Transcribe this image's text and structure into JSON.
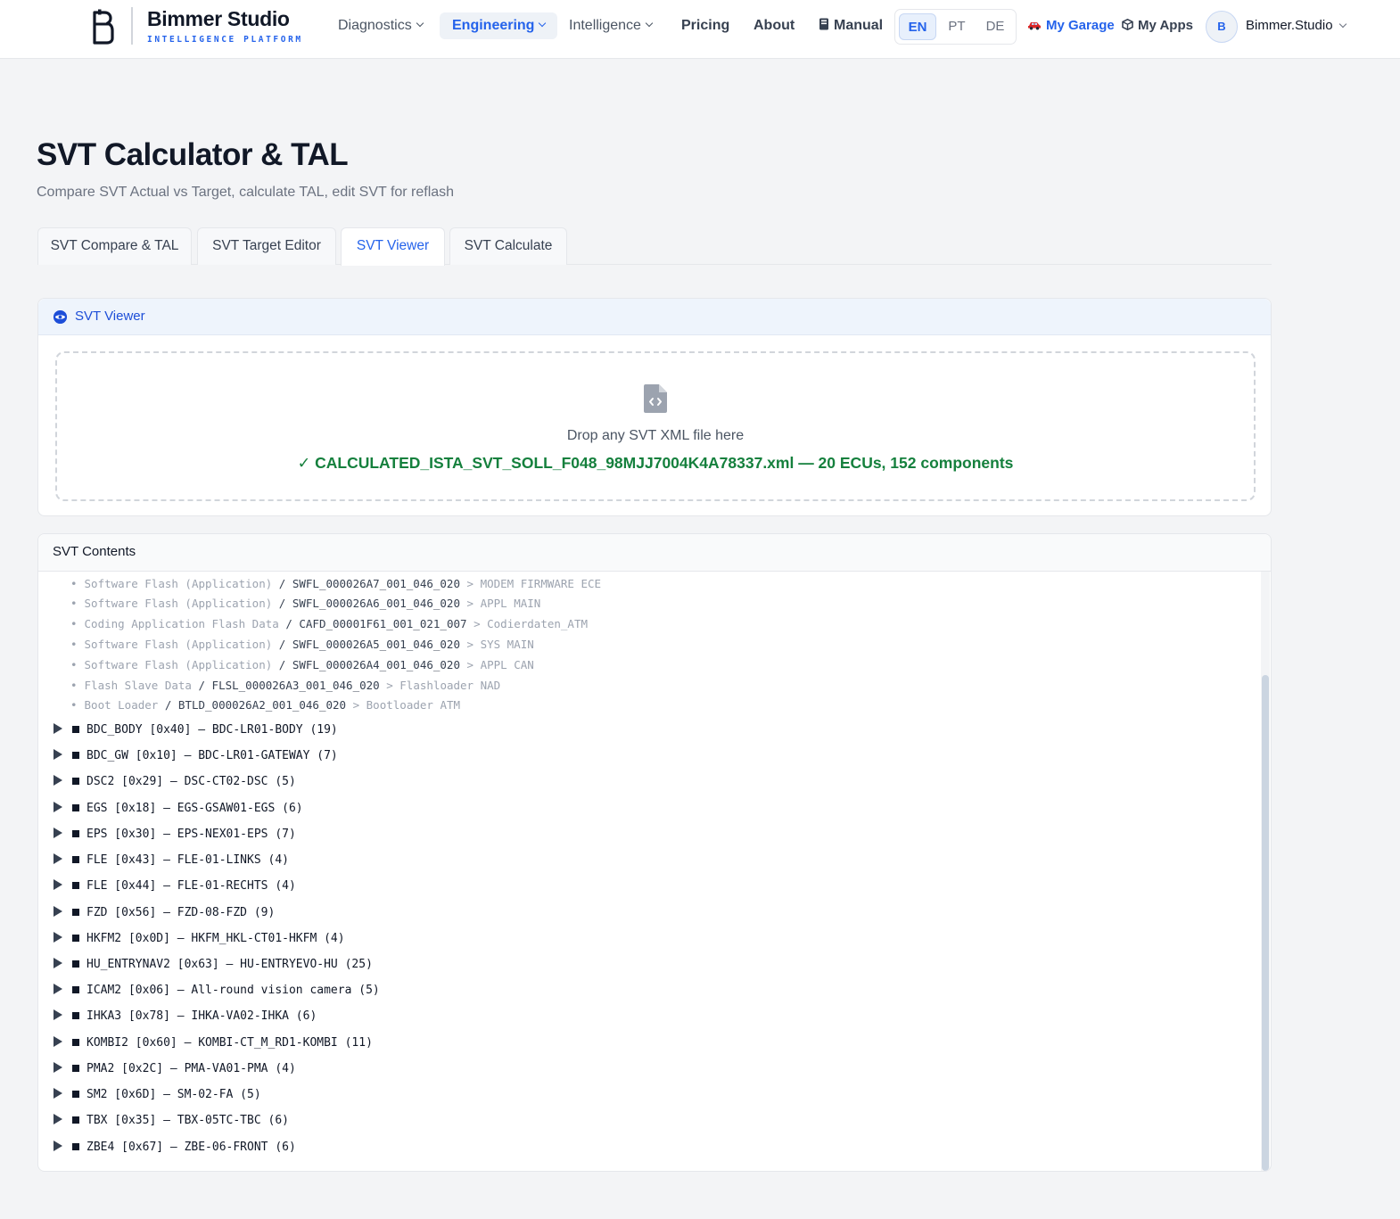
{
  "brand": {
    "name": "Bimmer Studio",
    "tagline": "INTELLIGENCE PLATFORM"
  },
  "nav": {
    "diagnostics": "Diagnostics",
    "engineering": "Engineering",
    "intelligence": "Intelligence",
    "pricing": "Pricing",
    "about": "About",
    "manual": "Manual"
  },
  "lang": {
    "en": "EN",
    "pt": "PT",
    "de": "DE",
    "selected": "EN"
  },
  "user_nav": {
    "garage": "My Garage",
    "apps": "My Apps",
    "avatar_initial": "B",
    "user_name": "Bimmer.Studio"
  },
  "page": {
    "title": "SVT Calculator & TAL",
    "subtitle": "Compare SVT Actual vs Target, calculate TAL, edit SVT for reflash"
  },
  "tabs": [
    {
      "label": "SVT Compare & TAL"
    },
    {
      "label": "SVT Target Editor"
    },
    {
      "label": "SVT Viewer"
    },
    {
      "label": "SVT Calculate"
    }
  ],
  "active_tab": "SVT Viewer",
  "viewer": {
    "title": "SVT Viewer",
    "drop_text": "Drop any SVT XML file here",
    "status": "✓ CALCULATED_ISTA_SVT_SOLL_F048_98MJJ7004K4A78337.xml — 20 ECUs, 152 components"
  },
  "contents": {
    "title": "SVT Contents",
    "components": [
      {
        "type": "Software Flash (Application)",
        "id": "SWFL_000026A7_001_046_020",
        "desc": "> MODEM FIRMWARE ECE"
      },
      {
        "type": "Software Flash (Application)",
        "id": "SWFL_000026A6_001_046_020",
        "desc": "> APPL MAIN"
      },
      {
        "type": "Coding Application Flash Data",
        "id": "CAFD_00001F61_001_021_007",
        "desc": "> Codierdaten_ATM"
      },
      {
        "type": "Software Flash (Application)",
        "id": "SWFL_000026A5_001_046_020",
        "desc": "> SYS MAIN"
      },
      {
        "type": "Software Flash (Application)",
        "id": "SWFL_000026A4_001_046_020",
        "desc": "> APPL CAN"
      },
      {
        "type": "Flash Slave Data",
        "id": "FLSL_000026A3_001_046_020",
        "desc": "> Flashloader NAD"
      },
      {
        "type": "Boot Loader",
        "id": "BTLD_000026A2_001_046_020",
        "desc": "> Bootloader ATM"
      }
    ],
    "separator": "/",
    "bullet": "•",
    "ecus": [
      {
        "label": "BDC_BODY [0x40] — BDC-LR01-BODY (19)"
      },
      {
        "label": "BDC_GW [0x10] — BDC-LR01-GATEWAY (7)"
      },
      {
        "label": "DSC2 [0x29] — DSC-CT02-DSC (5)"
      },
      {
        "label": "EGS [0x18] — EGS-GSAW01-EGS (6)"
      },
      {
        "label": "EPS [0x30] — EPS-NEX01-EPS (7)"
      },
      {
        "label": "FLE [0x43] — FLE-01-LINKS (4)"
      },
      {
        "label": "FLE [0x44] — FLE-01-RECHTS (4)"
      },
      {
        "label": "FZD [0x56] — FZD-08-FZD (9)"
      },
      {
        "label": "HKFM2 [0x0D] — HKFM_HKL-CT01-HKFM (4)"
      },
      {
        "label": "HU_ENTRYNAV2 [0x63] — HU-ENTRYEVO-HU (25)"
      },
      {
        "label": "ICAM2 [0x06] — All-round vision camera (5)"
      },
      {
        "label": "IHKA3 [0x78] — IHKA-VA02-IHKA (6)"
      },
      {
        "label": "KOMBI2 [0x60] — KOMBI-CT_M_RD1-KOMBI (11)"
      },
      {
        "label": "PMA2 [0x2C] — PMA-VA01-PMA (4)"
      },
      {
        "label": "SM2 [0x6D] — SM-02-FA (5)"
      },
      {
        "label": "TBX [0x35] — TBX-05TC-TBC (6)"
      },
      {
        "label": "ZBE4 [0x67] — ZBE-06-FRONT (6)"
      }
    ]
  },
  "colors": {
    "accent": "#2563eb",
    "success": "#15803d",
    "muted": "#9ca3af"
  }
}
